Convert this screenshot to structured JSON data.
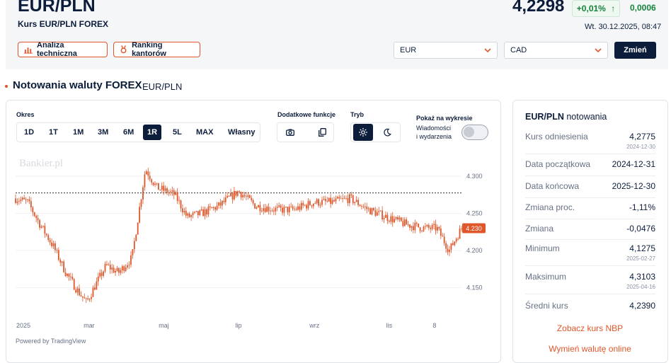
{
  "header": {
    "pair_title": "EUR/PLN",
    "subtitle": "Kurs EUR/PLN FOREX",
    "price": "4,2298",
    "change_pct": "+0,01%",
    "change_arrow": "↑",
    "change_abs": "0,0006",
    "datetime": "Wt. 30.12.2025, 08:47",
    "btn_analysis": "Analiza techniczna",
    "btn_ranking": "Ranking kantorów",
    "select_from": "EUR",
    "select_to": "CAD",
    "btn_change": "Zmień",
    "colors": {
      "accent": "#e0562b",
      "navy": "#0c1d3b",
      "positive": "#16833b"
    }
  },
  "section": {
    "title": "Notowania waluty FOREX",
    "pair": "EUR/PLN"
  },
  "controls": {
    "period_label": "Okres",
    "periods": [
      "1D",
      "1T",
      "1M",
      "3M",
      "6M",
      "1R",
      "5L",
      "MAX",
      "Własny"
    ],
    "active_period": "1R",
    "extra_label": "Dodatkowe funkcje",
    "mode_label": "Tryb",
    "show_label": "Pokaż na wykresie",
    "news_label_1": "Wiadomości",
    "news_label_2": "i wydarzenia",
    "icons": [
      "camera-icon",
      "copy-icon",
      "sun-icon",
      "moon-icon"
    ]
  },
  "chart_data": {
    "type": "candlestick",
    "watermark": "Bankier.pl",
    "credit": "Powered by TradingView",
    "yticks": [
      "4.300",
      "4.250",
      "4.200",
      "4.150"
    ],
    "ylim": [
      4.12,
      4.32
    ],
    "xticks": [
      "2025",
      "mar",
      "maj",
      "lip",
      "wrz",
      "lis",
      "8"
    ],
    "reference_line": 4.2775,
    "last_value": 4.23,
    "last_label": "4.230",
    "series_color": "#e0562b",
    "close_path": [
      [
        "2024-12-31",
        4.27
      ],
      [
        "2025-01-10",
        4.265
      ],
      [
        "2025-01-20",
        4.235
      ],
      [
        "2025-01-31",
        4.205
      ],
      [
        "2025-02-10",
        4.17
      ],
      [
        "2025-02-20",
        4.145
      ],
      [
        "2025-02-27",
        4.13
      ],
      [
        "2025-03-05",
        4.15
      ],
      [
        "2025-03-15",
        4.18
      ],
      [
        "2025-03-25",
        4.17
      ],
      [
        "2025-04-05",
        4.19
      ],
      [
        "2025-04-16",
        4.31
      ],
      [
        "2025-04-25",
        4.285
      ],
      [
        "2025-05-10",
        4.275
      ],
      [
        "2025-05-20",
        4.245
      ],
      [
        "2025-06-01",
        4.25
      ],
      [
        "2025-06-15",
        4.26
      ],
      [
        "2025-07-01",
        4.28
      ],
      [
        "2025-07-15",
        4.26
      ],
      [
        "2025-08-01",
        4.255
      ],
      [
        "2025-08-15",
        4.255
      ],
      [
        "2025-09-01",
        4.265
      ],
      [
        "2025-09-15",
        4.265
      ],
      [
        "2025-09-30",
        4.27
      ],
      [
        "2025-10-15",
        4.255
      ],
      [
        "2025-10-30",
        4.245
      ],
      [
        "2025-11-15",
        4.235
      ],
      [
        "2025-11-30",
        4.23
      ],
      [
        "2025-12-10",
        4.23
      ],
      [
        "2025-12-20",
        4.2
      ],
      [
        "2025-12-30",
        4.23
      ]
    ]
  },
  "stats": {
    "pair": "EUR/PLN",
    "title_suffix": "notowania",
    "rows": [
      {
        "label": "Kurs odniesienia",
        "value": "4,2775",
        "date": "2024-12-30"
      },
      {
        "label": "Data początkowa",
        "value": "2024-12-31",
        "date": ""
      },
      {
        "label": "Data końcowa",
        "value": "2025-12-30",
        "date": ""
      },
      {
        "label": "Zmiana proc.",
        "value": "-1,11%",
        "date": ""
      },
      {
        "label": "Zmiana",
        "value": "-0,0476",
        "date": ""
      },
      {
        "label": "Minimum",
        "value": "4,1275",
        "date": "2025-02-27"
      },
      {
        "label": "Maksimum",
        "value": "4,3103",
        "date": "2025-04-16"
      },
      {
        "label": "Średni kurs",
        "value": "4,2390",
        "date": ""
      }
    ],
    "link_nbp": "Zobacz kurs NBP",
    "link_exchange": "Wymień walutę online"
  }
}
